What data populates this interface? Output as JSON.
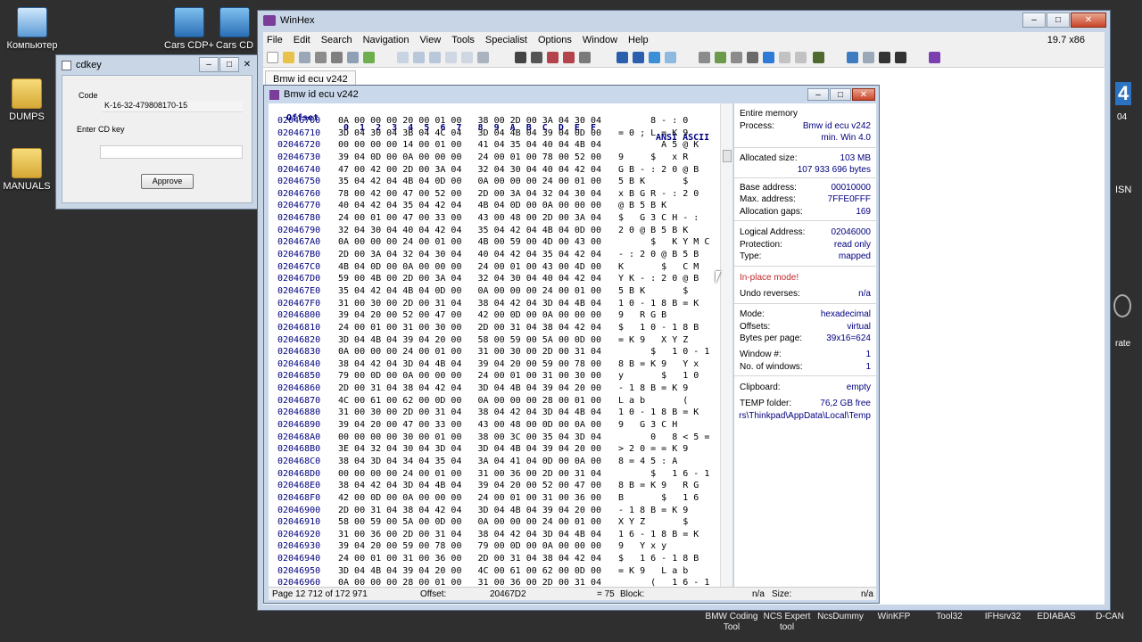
{
  "desktop": {
    "icons": [
      {
        "label": "Компьютер"
      },
      {
        "label": "DUMPS"
      },
      {
        "label": "MANUALS"
      },
      {
        "label": "Cars CDP+"
      },
      {
        "label": "Cars CD"
      }
    ],
    "taskbar": [
      {
        "label": "BMW Coding Tool"
      },
      {
        "label": "NCS Expert tool"
      },
      {
        "label": "NcsDummy"
      },
      {
        "label": "WinKFP"
      },
      {
        "label": "Tool32"
      },
      {
        "label": "IFHsrv32"
      },
      {
        "label": "EDIABAS"
      },
      {
        "label": "D-CAN"
      }
    ],
    "edge_labels": [
      "4",
      "04",
      "ISN",
      "rate"
    ]
  },
  "cdkey": {
    "title": "cdkey",
    "code_label": "Code",
    "code_value": "K-16-32-479808170-15",
    "enter_label": "Enter CD key",
    "enter_value": "",
    "approve": "Approve"
  },
  "winhex": {
    "title": "WinHex",
    "version": "19.7 x86",
    "menu": [
      "File",
      "Edit",
      "Search",
      "Navigation",
      "View",
      "Tools",
      "Specialist",
      "Options",
      "Window",
      "Help"
    ],
    "tab": "Bmw id ecu v242"
  },
  "doc": {
    "title": "Bmw id ecu v242",
    "header": {
      "offset": "Offset",
      "columns": "0  1  2  3  4  5  6  7   8  9  A  B  C  D  E  F",
      "ascii": "ANSI ASCII"
    },
    "rows": [
      {
        "off": "02046700",
        "hex": "0A 00 00 00 20 00 01 00   38 00 2D 00 3A 04 30 04",
        "asc": "      8 - : 0"
      },
      {
        "off": "02046710",
        "hex": "3D 04 30 04 3B 04 4C 04   3D 04 4B 04 39 04 0D 00",
        "asc": "= 0 ; L = K 9"
      },
      {
        "off": "02046720",
        "hex": "00 00 00 00 14 00 01 00   41 04 35 04 40 04 4B 04",
        "asc": "        A 5 @ K"
      },
      {
        "off": "02046730",
        "hex": "39 04 0D 00 0A 00 00 00   24 00 01 00 78 00 52 00",
        "asc": "9     $   x R"
      },
      {
        "off": "02046740",
        "hex": "47 00 42 00 2D 00 3A 04   32 04 30 04 40 04 42 04",
        "asc": "G B - : 2 0 @ B"
      },
      {
        "off": "02046750",
        "hex": "35 04 42 04 4B 04 0D 00   0A 00 00 00 24 00 01 00",
        "asc": "5 B K       $"
      },
      {
        "off": "02046760",
        "hex": "78 00 42 00 47 00 52 00   2D 00 3A 04 32 04 30 04",
        "asc": "x B G R - : 2 0"
      },
      {
        "off": "02046770",
        "hex": "40 04 42 04 35 04 42 04   4B 04 0D 00 0A 00 00 00",
        "asc": "@ B 5 B K"
      },
      {
        "off": "02046780",
        "hex": "24 00 01 00 47 00 33 00   43 00 48 00 2D 00 3A 04",
        "asc": "$   G 3 C H - :"
      },
      {
        "off": "02046790",
        "hex": "32 04 30 04 40 04 42 04   35 04 42 04 4B 04 0D 00",
        "asc": "2 0 @ B 5 B K"
      },
      {
        "off": "020467A0",
        "hex": "0A 00 00 00 24 00 01 00   4B 00 59 00 4D 00 43 00",
        "asc": "      $   K Y M C"
      },
      {
        "off": "020467B0",
        "hex": "2D 00 3A 04 32 04 30 04   40 04 42 04 35 04 42 04",
        "asc": "- : 2 0 @ B 5 B"
      },
      {
        "off": "020467C0",
        "hex": "4B 04 0D 00 0A 00 00 00   24 00 01 00 43 00 4D 00",
        "asc": "K       $   C M"
      },
      {
        "off": "020467D0",
        "hex": "59 00 4B 00 2D 00 3A 04   32 04 30 04 40 04 42 04",
        "asc": "Y K - : 2 0 @ B"
      },
      {
        "off": "020467E0",
        "hex": "35 04 42 04 4B 04 0D 00   0A 00 00 00 24 00 01 00",
        "asc": "5 B K       $"
      },
      {
        "off": "020467F0",
        "hex": "31 00 30 00 2D 00 31 04   38 04 42 04 3D 04 4B 04",
        "asc": "1 0 - 1 8 B = K"
      },
      {
        "off": "02046800",
        "hex": "39 04 20 00 52 00 47 00   42 00 0D 00 0A 00 00 00",
        "asc": "9   R G B"
      },
      {
        "off": "02046810",
        "hex": "24 00 01 00 31 00 30 00   2D 00 31 04 38 04 42 04",
        "asc": "$   1 0 - 1 8 B"
      },
      {
        "off": "02046820",
        "hex": "3D 04 4B 04 39 04 20 00   58 00 59 00 5A 00 0D 00",
        "asc": "= K 9   X Y Z"
      },
      {
        "off": "02046830",
        "hex": "0A 00 00 00 24 00 01 00   31 00 30 00 2D 00 31 04",
        "asc": "      $   1 0 - 1"
      },
      {
        "off": "02046840",
        "hex": "38 04 42 04 3D 04 4B 04   39 04 20 00 59 00 78 00",
        "asc": "8 B = K 9   Y x"
      },
      {
        "off": "02046850",
        "hex": "79 00 0D 00 0A 00 00 00   24 00 01 00 31 00 30 00",
        "asc": "y       $   1 0"
      },
      {
        "off": "02046860",
        "hex": "2D 00 31 04 38 04 42 04   3D 04 4B 04 39 04 20 00",
        "asc": "- 1 8 B = K 9"
      },
      {
        "off": "02046870",
        "hex": "4C 00 61 00 62 00 0D 00   0A 00 00 00 28 00 01 00",
        "asc": "L a b       ("
      },
      {
        "off": "02046880",
        "hex": "31 00 30 00 2D 00 31 04   38 04 42 04 3D 04 4B 04",
        "asc": "1 0 - 1 8 B = K"
      },
      {
        "off": "02046890",
        "hex": "39 04 20 00 47 00 33 00   43 00 48 00 0D 00 0A 00",
        "asc": "9   G 3 C H"
      },
      {
        "off": "020468A0",
        "hex": "00 00 00 00 30 00 01 00   38 00 3C 00 35 04 3D 04",
        "asc": "      0   8 < 5 ="
      },
      {
        "off": "020468B0",
        "hex": "3E 04 32 04 30 04 3D 04   3D 04 4B 04 39 04 20 00",
        "asc": "> 2 0 = = K 9"
      },
      {
        "off": "020468C0",
        "hex": "38 04 3D 04 34 04 35 04   3A 04 41 04 0D 00 0A 00",
        "asc": "8 = 4 5 : A"
      },
      {
        "off": "020468D0",
        "hex": "00 00 00 00 24 00 01 00   31 00 36 00 2D 00 31 04",
        "asc": "      $   1 6 - 1"
      },
      {
        "off": "020468E0",
        "hex": "38 04 42 04 3D 04 4B 04   39 04 20 00 52 00 47 00",
        "asc": "8 B = K 9   R G"
      },
      {
        "off": "020468F0",
        "hex": "42 00 0D 00 0A 00 00 00   24 00 01 00 31 00 36 00",
        "asc": "B       $   1 6"
      },
      {
        "off": "02046900",
        "hex": "2D 00 31 04 38 04 42 04   3D 04 4B 04 39 04 20 00",
        "asc": "- 1 8 B = K 9"
      },
      {
        "off": "02046910",
        "hex": "58 00 59 00 5A 00 0D 00   0A 00 00 00 24 00 01 00",
        "asc": "X Y Z       $"
      },
      {
        "off": "02046920",
        "hex": "31 00 36 00 2D 00 31 04   38 04 42 04 3D 04 4B 04",
        "asc": "1 6 - 1 8 B = K"
      },
      {
        "off": "02046930",
        "hex": "39 04 20 00 59 00 78 00   79 00 0D 00 0A 00 00 00",
        "asc": "9   Y x y"
      },
      {
        "off": "02046940",
        "hex": "24 00 01 00 31 00 36 00   2D 00 31 04 38 04 42 04",
        "asc": "$   1 6 - 1 8 B"
      },
      {
        "off": "02046950",
        "hex": "3D 04 4B 04 39 04 20 00   4C 00 61 00 62 00 0D 00",
        "asc": "= K 9   L a b"
      },
      {
        "off": "02046960",
        "hex": "0A 00 00 00 28 00 01 00   31 00 36 00 2D 00 31 04",
        "asc": "      (   1 6 - 1"
      }
    ],
    "info": {
      "entire_memory": "Entire memory",
      "process_label": "Process:",
      "process_value": "Bmw id ecu v242",
      "process_sub": "min. Win 4.0",
      "alloc_label": "Allocated size:",
      "alloc_mb": "103 MB",
      "alloc_bytes": "107 933 696 bytes",
      "base_label": "Base address:",
      "base_value": "00010000",
      "max_label": "Max. address:",
      "max_value": "7FFE0FFF",
      "gaps_label": "Allocation gaps:",
      "gaps_value": "169",
      "logical_label": "Logical Address:",
      "logical_value": "02046000",
      "protection_label": "Protection:",
      "protection_value": "read only",
      "type_label": "Type:",
      "type_value": "mapped",
      "inplace": "In-place mode!",
      "undo_label": "Undo reverses:",
      "undo_value": "n/a",
      "mode_label": "Mode:",
      "mode_value": "hexadecimal",
      "offsets_label": "Offsets:",
      "offsets_value": "virtual",
      "bpp_label": "Bytes per page:",
      "bpp_value": "39x16=624",
      "window_label": "Window #:",
      "window_value": "1",
      "nwin_label": "No. of windows:",
      "nwin_value": "1",
      "clip_label": "Clipboard:",
      "clip_value": "empty",
      "temp_label": "TEMP folder:",
      "temp_value": "76,2 GB free",
      "temp_path": "rs\\Thinkpad\\AppData\\Local\\Temp"
    },
    "status": {
      "page": "Page 12 712 of 172 971",
      "offset_label": "Offset:",
      "offset_value": "20467D2",
      "eq": "= 75",
      "block_label": "Block:",
      "block_value": "n/a",
      "size_label": "Size:",
      "size_value": "n/a"
    }
  }
}
